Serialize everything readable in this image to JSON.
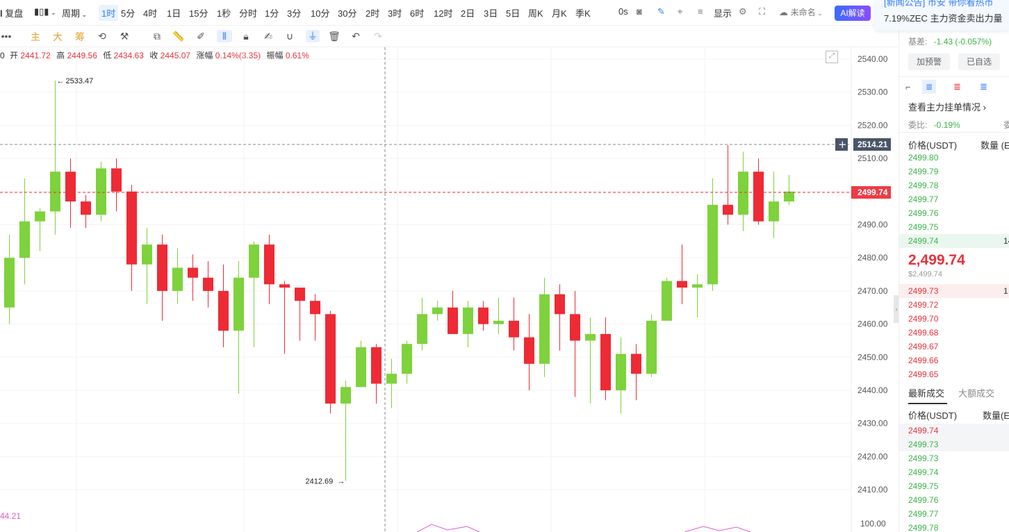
{
  "toolbar": {
    "replay_label": "复盘",
    "period_label": "周期",
    "intervals": [
      "1时",
      "5分",
      "4时",
      "1日",
      "15分",
      "1秒",
      "分时",
      "1分",
      "3分",
      "10分",
      "30分",
      "2时",
      "3时",
      "6时",
      "12时",
      "2日",
      "3日",
      "5日",
      "周K",
      "月K",
      "季K"
    ],
    "selected_interval": "1时",
    "countdown": "0s",
    "display_label": "显示",
    "unnamed_label": "未命名",
    "ai_label": "AI解读"
  },
  "toolbar2": {
    "main_label": "主",
    "big_label": "大",
    "chip_label": "筹"
  },
  "ohlc": {
    "prefix": "0",
    "open_label": "开",
    "open": "2441.72",
    "high_label": "高",
    "high": "2449.56",
    "low_label": "低",
    "low": "2434.63",
    "close_label": "收",
    "close": "2445.07",
    "change_label": "涨幅",
    "change": "0.14%(3.35)",
    "amp_label": "振幅",
    "amp": "0.61%"
  },
  "indicator_value": "44.21",
  "chart_data": {
    "type": "candlestick",
    "ylim": [
      2405,
      2545
    ],
    "yticks": [
      "2540.00",
      "2530.00",
      "2520.00",
      "2510.00",
      "2500.00",
      "2490.00",
      "2480.00",
      "2470.00",
      "2460.00",
      "2450.00",
      "2440.00",
      "2430.00",
      "2420.00",
      "2410.00"
    ],
    "sub_tick": "100.00",
    "crosshair_price": "2514.21",
    "current_price": "2499.74",
    "high_marker": "2533.47",
    "low_marker": "2412.69",
    "candles": [
      [
        2465,
        2480,
        2460,
        2487
      ],
      [
        2480,
        2491,
        2472,
        2504
      ],
      [
        2491,
        2494,
        2482,
        2495
      ],
      [
        2494,
        2506,
        2487,
        2533.47
      ],
      [
        2506,
        2497,
        2489,
        2510
      ],
      [
        2497,
        2493,
        2489,
        2499
      ],
      [
        2493,
        2507,
        2491,
        2509
      ],
      [
        2507,
        2500,
        2494,
        2510
      ],
      [
        2500,
        2478,
        2470,
        2502
      ],
      [
        2478,
        2484,
        2466,
        2489
      ],
      [
        2484,
        2470,
        2461,
        2487
      ],
      [
        2470,
        2477,
        2466,
        2483
      ],
      [
        2477,
        2474,
        2467,
        2481
      ],
      [
        2474,
        2470,
        2465,
        2479
      ],
      [
        2470,
        2458,
        2453,
        2478
      ],
      [
        2458,
        2474,
        2439,
        2479
      ],
      [
        2474,
        2484,
        2453,
        2485
      ],
      [
        2484,
        2472,
        2466,
        2487
      ],
      [
        2472,
        2471,
        2451,
        2473
      ],
      [
        2471,
        2467,
        2455,
        2471
      ],
      [
        2467,
        2463,
        2455,
        2469
      ],
      [
        2463,
        2436,
        2433,
        2464
      ],
      [
        2436,
        2441,
        2412.69,
        2443
      ],
      [
        2441,
        2453,
        2441,
        2455
      ],
      [
        2453,
        2442,
        2436,
        2454
      ],
      [
        2442,
        2445,
        2434.63,
        2449.56
      ],
      [
        2445,
        2454,
        2442,
        2455
      ],
      [
        2454,
        2463,
        2452,
        2468
      ],
      [
        2463,
        2465,
        2461,
        2467
      ],
      [
        2465,
        2457,
        2457,
        2470
      ],
      [
        2457,
        2465,
        2453,
        2467
      ],
      [
        2465,
        2460,
        2458,
        2467
      ],
      [
        2460,
        2461,
        2457,
        2468
      ],
      [
        2461,
        2456,
        2452,
        2468
      ],
      [
        2456,
        2448,
        2440,
        2463
      ],
      [
        2448,
        2469,
        2444,
        2474
      ],
      [
        2469,
        2463,
        2452,
        2472
      ],
      [
        2463,
        2455,
        2438,
        2470
      ],
      [
        2455,
        2457,
        2436,
        2462
      ],
      [
        2457,
        2440,
        2437,
        2462
      ],
      [
        2440,
        2451,
        2433,
        2456
      ],
      [
        2451,
        2445,
        2437,
        2454
      ],
      [
        2445,
        2461,
        2444,
        2463
      ],
      [
        2461,
        2473,
        2461,
        2474
      ],
      [
        2473,
        2471,
        2466,
        2484
      ],
      [
        2471,
        2472,
        2462,
        2475
      ],
      [
        2472,
        2496,
        2470,
        2504
      ],
      [
        2496,
        2493,
        2490,
        2514
      ],
      [
        2493,
        2506,
        2488,
        2512
      ],
      [
        2506,
        2491,
        2490,
        2510
      ],
      [
        2491,
        2497,
        2486,
        2506
      ],
      [
        2497,
        2500,
        2496,
        2505
      ]
    ]
  },
  "right": {
    "notice_line1": "[新闻公告] 币安 带你看热币",
    "notice_line2": "7.19%ZEC 主力资金卖出力量",
    "basis_label": "基差:",
    "basis_value": "-1.43 (-0.057%)",
    "alert_btn": "加预警",
    "watch_btn": "已自选",
    "main_orders": "查看主力挂单情况",
    "ratio_label": "委比:",
    "ratio_value": "-0.19%",
    "ratio_tail": "委",
    "price_col": "价格(USDT)",
    "qty_col": "数量 (E",
    "asks": [
      "2499.80",
      "2499.79",
      "2499.78",
      "2499.77",
      "2499.76",
      "2499.75",
      "2499.74"
    ],
    "ask_tail": "14",
    "last_price": "2,499.74",
    "last_price_sub": "$2,499.74",
    "bids": [
      "2499.73",
      "2499.72",
      "2499.70",
      "2499.68",
      "2499.67",
      "2499.66",
      "2499.65"
    ],
    "bid_tail": "1",
    "tab_latest": "最新成交",
    "tab_large": "大额成交",
    "price_col2": "价格(USDT)",
    "qty_col2": "数量(E",
    "trades": [
      {
        "p": "2499.74",
        "c": "red"
      },
      {
        "p": "2499.73",
        "c": "green"
      },
      {
        "p": "2499.73",
        "c": "green"
      },
      {
        "p": "2499.74",
        "c": "green"
      },
      {
        "p": "2499.75",
        "c": "green"
      },
      {
        "p": "2499.76",
        "c": "green"
      },
      {
        "p": "2499.77",
        "c": "green"
      },
      {
        "p": "2499.78",
        "c": "green"
      }
    ]
  },
  "colors": {
    "up": "#7ed23c",
    "down": "#ee2a35",
    "accent": "#2f7bff"
  }
}
